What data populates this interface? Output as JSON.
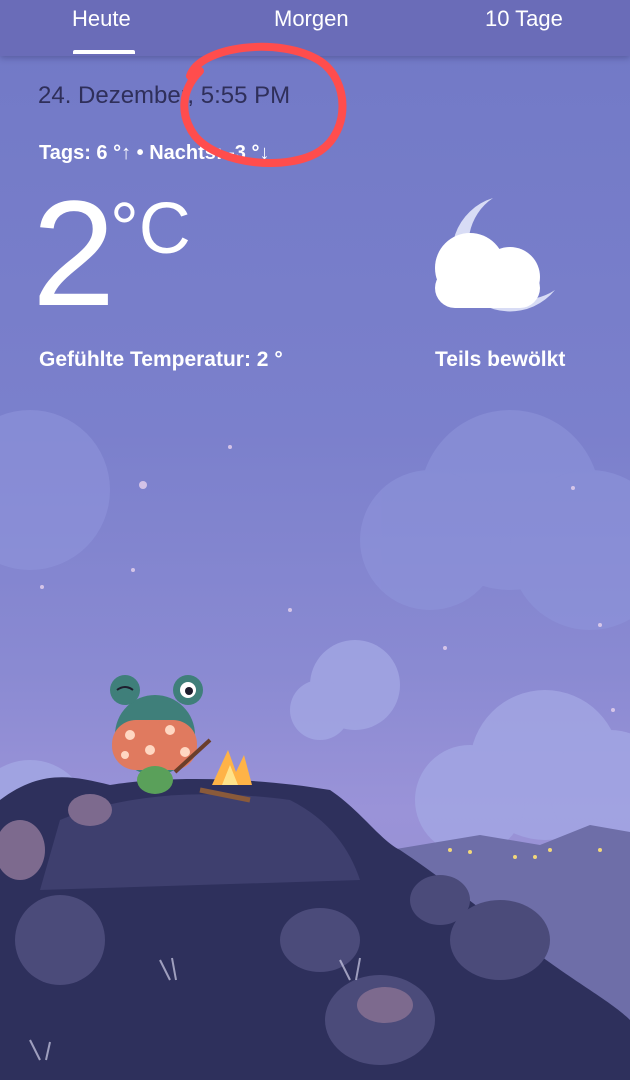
{
  "tabs": [
    "Heute",
    "Morgen",
    "10 Tage"
  ],
  "date_time": "24. Dezember, 5:55 PM",
  "day_night": "Tags: 6 °↑ • Nachts: -3 °↓",
  "temperature": {
    "value": "2",
    "unit": "°C"
  },
  "feels_like": "Gefühlte Temperatur: 2 °",
  "condition": {
    "label": "Teils bewölkt",
    "icon": "partly-cloudy-night-icon"
  },
  "colors": {
    "tab_bar": "#6a6cb8",
    "sky": "#7b80cc",
    "annotation": "#ff4d4d"
  }
}
